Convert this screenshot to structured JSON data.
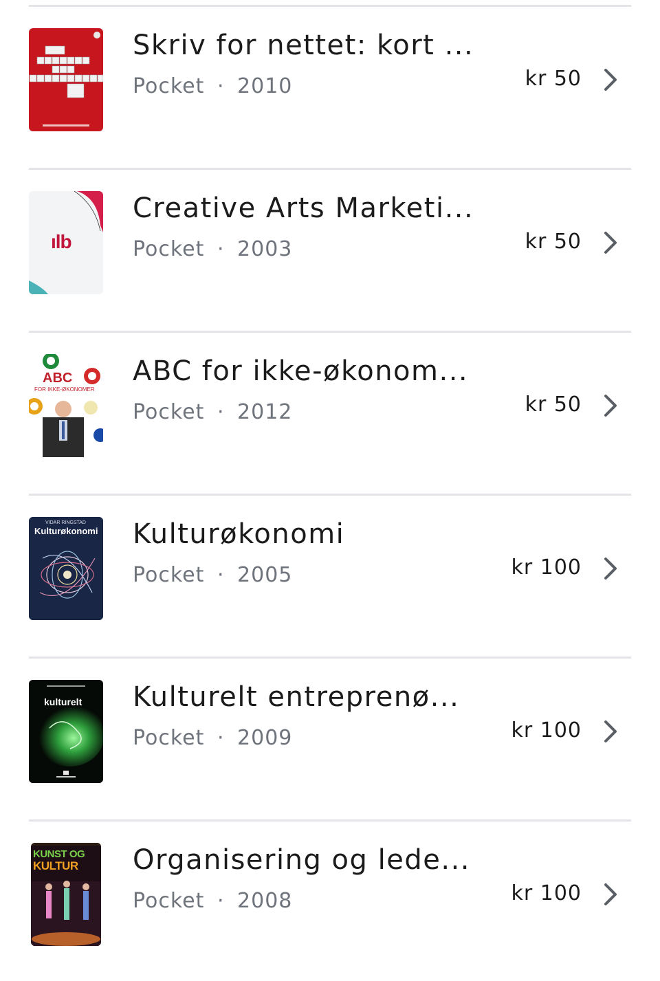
{
  "items": [
    {
      "title": "Skriv for nettet: kort ...",
      "format": "Pocket",
      "separator": "·",
      "year": "2010",
      "price": "kr 50",
      "cover_icon": "book-cover-red-crossword"
    },
    {
      "title": "Creative Arts Marketi...",
      "format": "Pocket",
      "separator": "·",
      "year": "2003",
      "price": "kr 50",
      "cover_icon": "book-cover-white-logo",
      "cover_text": "ılb"
    },
    {
      "title": "ABC for ikke-økonom...",
      "format": "Pocket",
      "separator": "·",
      "year": "2012",
      "price": "kr 50",
      "cover_icon": "book-cover-abc-balls",
      "cover_text": "ABC",
      "cover_subtext": "FOR IKKE-ØKONOMER"
    },
    {
      "title": "Kulturøkonomi",
      "format": "Pocket",
      "separator": "·",
      "year": "2005",
      "price": "kr 100",
      "cover_icon": "book-cover-dark-blue-abstract",
      "cover_text": "Kulturøkonomi",
      "cover_subtext": "VIDAR RINGSTAD"
    },
    {
      "title": "Kulturelt entreprenø...",
      "format": "Pocket",
      "separator": "·",
      "year": "2009",
      "price": "kr 100",
      "cover_icon": "book-cover-green-glow",
      "cover_text": "kulturelt"
    },
    {
      "title": "Organisering og lede...",
      "format": "Pocket",
      "separator": "·",
      "year": "2008",
      "price": "kr 100",
      "cover_icon": "book-cover-dancers",
      "cover_text": "KUNST OG",
      "cover_subtext": "KULTUR"
    }
  ],
  "colors": {
    "divider": "#e3e4e8",
    "meta_text": "#6f747c",
    "chevron": "#5a5f66"
  }
}
